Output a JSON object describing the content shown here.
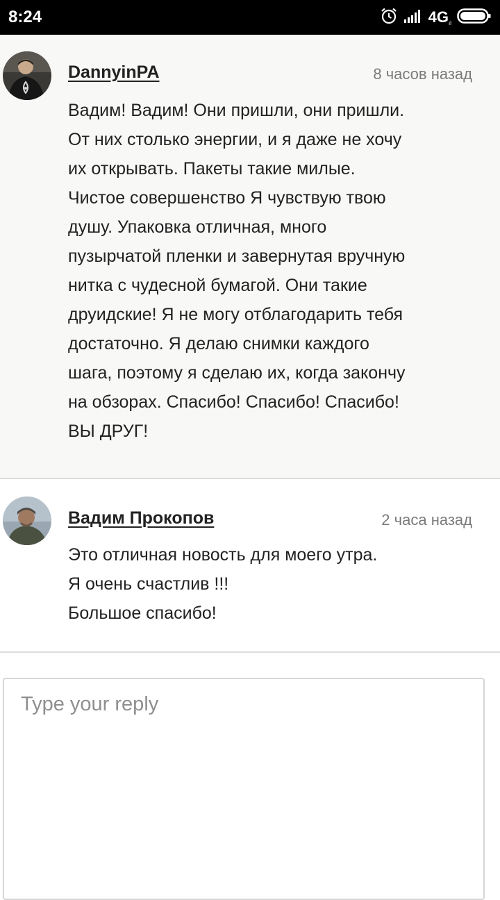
{
  "status_bar": {
    "time": "8:24",
    "network": "4G",
    "network_sub": "ıl",
    "icons": [
      "alarm-icon",
      "signal-icon",
      "network-4g-icon",
      "battery-icon"
    ]
  },
  "comments": [
    {
      "author": "DannyinPA",
      "time": "8 часов назад",
      "text": "Вадим! Вадим! Они пришли, они пришли.\nОт них столько энергии, и я даже не хочу\nих открывать. Пакеты такие милые.\nЧистое совершенство Я чувствую твою\nдушу. Упаковка отличная, много\nпузырчатой пленки и завернутая вручную\nнитка с чудесной бумагой. Они такие\nдруидские! Я не могу отблагодарить тебя\nдостаточно. Я делаю снимки каждого\nшага, поэтому я сделаю их, когда закончу\nна обзорах. Спасибо! Спасибо! Спасибо!\nВЫ ДРУГ!"
    },
    {
      "author": "Вадим Прокопов",
      "time": "2 часа назад",
      "text": "Это отличная новость для моего утра.\nЯ очень счастлив !!!\nБольшое спасибо!"
    }
  ],
  "reply": {
    "placeholder": "Type your reply",
    "value": ""
  },
  "colors": {
    "status_bar_bg": "#000000",
    "highlight_comment_bg": "#f8f8f7",
    "text": "#222222",
    "muted_text": "#7a7a7a",
    "divider": "#dcdcdc"
  }
}
